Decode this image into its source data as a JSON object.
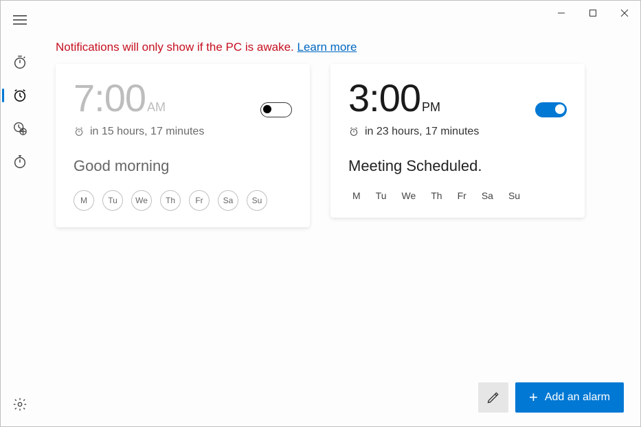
{
  "notice": {
    "text": "Notifications will only show if the PC is awake. ",
    "link": "Learn more"
  },
  "sidebar": {
    "items": [
      {
        "name": "timer",
        "active": false
      },
      {
        "name": "alarm",
        "active": true
      },
      {
        "name": "world-clock",
        "active": false
      },
      {
        "name": "stopwatch",
        "active": false
      }
    ]
  },
  "alarms": [
    {
      "time": "7:00",
      "ampm": "AM",
      "enabled": false,
      "countdown": "in 15 hours, 17 minutes",
      "label": "Good morning",
      "days": [
        "M",
        "Tu",
        "We",
        "Th",
        "Fr",
        "Sa",
        "Su"
      ]
    },
    {
      "time": "3:00",
      "ampm": "PM",
      "enabled": true,
      "countdown": "in 23 hours, 17 minutes",
      "label": "Meeting Scheduled.",
      "days": [
        "M",
        "Tu",
        "We",
        "Th",
        "Fr",
        "Sa",
        "Su"
      ]
    }
  ],
  "buttons": {
    "add": "Add an alarm"
  }
}
